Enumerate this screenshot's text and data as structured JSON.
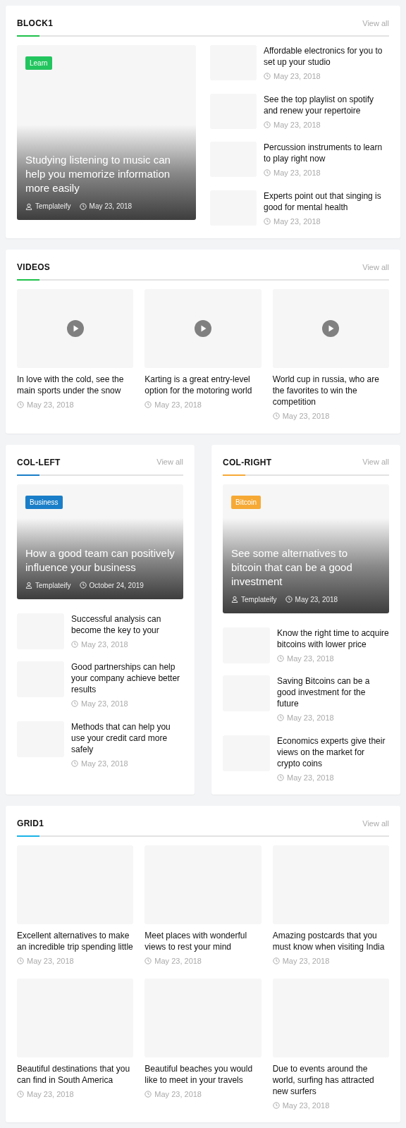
{
  "sections": [
    {
      "kind": "block",
      "title": "BLOCK1",
      "link": "View all",
      "color": "#1ec24a",
      "featured": {
        "tag": {
          "label": "Learn",
          "color": "#22c55e"
        },
        "title": "Studying listening to music can help you memorize information more easily",
        "author": "Templateify",
        "date": "May 23, 2018"
      },
      "items": [
        {
          "title": "Affordable electronics for you to set up your studio",
          "date": "May 23, 2018"
        },
        {
          "title": "See the top playlist on spotify and renew your repertoire",
          "date": "May 23, 2018"
        },
        {
          "title": "Percussion instruments to learn to play right now",
          "date": "May 23, 2018"
        },
        {
          "title": "Experts point out that singing is good for mental health",
          "date": "May 23, 2018"
        }
      ]
    },
    {
      "kind": "videos",
      "title": "VIDEOS",
      "link": "View all",
      "color": "#1ec24a",
      "items": [
        {
          "title": "In love with the cold, see the main sports under the snow",
          "date": "May 23, 2018"
        },
        {
          "title": "Karting is a great entry-level option for the motoring world",
          "date": "May 23, 2018"
        },
        {
          "title": "World cup in russia, who are the favorites to win the competition",
          "date": "May 23, 2018"
        }
      ]
    },
    {
      "kind": "columns",
      "columns": [
        {
          "title": "COL-LEFT",
          "link": "View all",
          "color": "#1a7ec8",
          "featured": {
            "tag": {
              "label": "Business",
              "color": "#1a7ec8"
            },
            "title": "How a good team can positively influence your business",
            "author": "Templateify",
            "date": "October 24, 2019"
          },
          "items": [
            {
              "title": "Successful analysis can become the key to your",
              "date": "May 23, 2018"
            },
            {
              "title": "Good partnerships can help your company achieve better results",
              "date": "May 23, 2018"
            },
            {
              "title": "Methods that can help you use your credit card more safely",
              "date": "May 23, 2018"
            }
          ]
        },
        {
          "title": "COL-RIGHT",
          "link": "View all",
          "color": "#f6a935",
          "featured": {
            "tag": {
              "label": "Bitcoin",
              "color": "#f6a935"
            },
            "title": "See some alternatives to bitcoin that can be a good investment",
            "author": "Templateify",
            "date": "May 23, 2018"
          },
          "items": [
            {
              "title": "Know the right time to acquire bitcoins with lower price",
              "date": "May 23, 2018"
            },
            {
              "title": "Saving Bitcoins can be a good investment for the future",
              "date": "May 23, 2018"
            },
            {
              "title": "Economics experts give their views on the market for crypto coins",
              "date": "May 23, 2018"
            }
          ]
        }
      ]
    },
    {
      "kind": "grid",
      "title": "GRID1",
      "link": "View all",
      "color": "#1ab3e8",
      "items": [
        {
          "title": "Excellent alternatives to make an incredible trip spending little",
          "date": "May 23, 2018"
        },
        {
          "title": "Meet places with wonderful views to rest your mind",
          "date": "May 23, 2018"
        },
        {
          "title": "Amazing postcards that you must know when visiting India",
          "date": "May 23, 2018"
        },
        {
          "title": "Beautiful destinations that you can find in South America",
          "date": "May 23, 2018"
        },
        {
          "title": "Beautiful beaches you would like to meet in your travels",
          "date": "May 23, 2018"
        },
        {
          "title": "Due to events around the world, surfing has attracted new surfers",
          "date": "May 23, 2018"
        }
      ]
    }
  ]
}
